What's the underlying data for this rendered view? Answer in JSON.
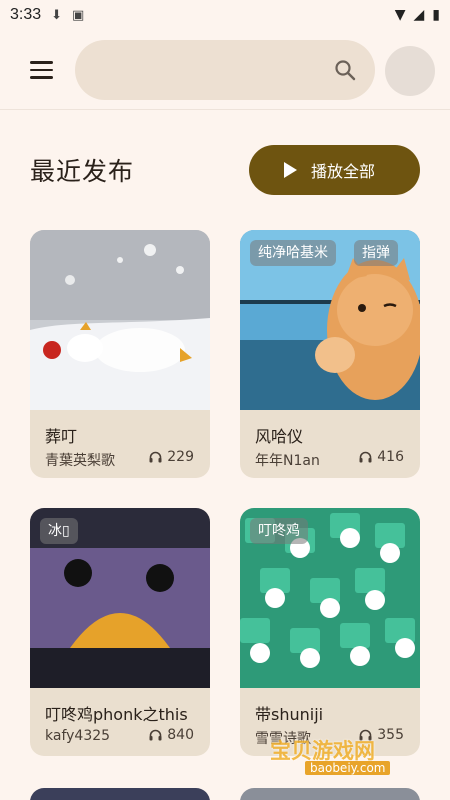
{
  "status": {
    "time": "3:33"
  },
  "appbar": {
    "search_placeholder": ""
  },
  "section": {
    "title": "最近发布",
    "play_all_label": "播放全部"
  },
  "cards": [
    {
      "title": "葬叮",
      "author": "青葉英梨歌",
      "plays": "229",
      "tags": []
    },
    {
      "title": "风哈仪",
      "author": "年年N1an",
      "plays": "416",
      "tags": [
        "纯净哈基米",
        "指弹"
      ]
    },
    {
      "title": "叮咚鸡phonk之this",
      "author": "kafy4325",
      "plays": "840",
      "tags": [
        "冰▯"
      ]
    },
    {
      "title": "带shuniji",
      "author": "雪雪诗歌",
      "plays": "355",
      "tags": [
        "叮咚鸡"
      ]
    }
  ],
  "watermark": {
    "text": "宝贝游戏网",
    "url": "baobeiy.com"
  },
  "colors": {
    "background": "#fdf4ee",
    "accent": "#6e5410",
    "card": "#eadfcf",
    "search": "#ede0d2"
  }
}
